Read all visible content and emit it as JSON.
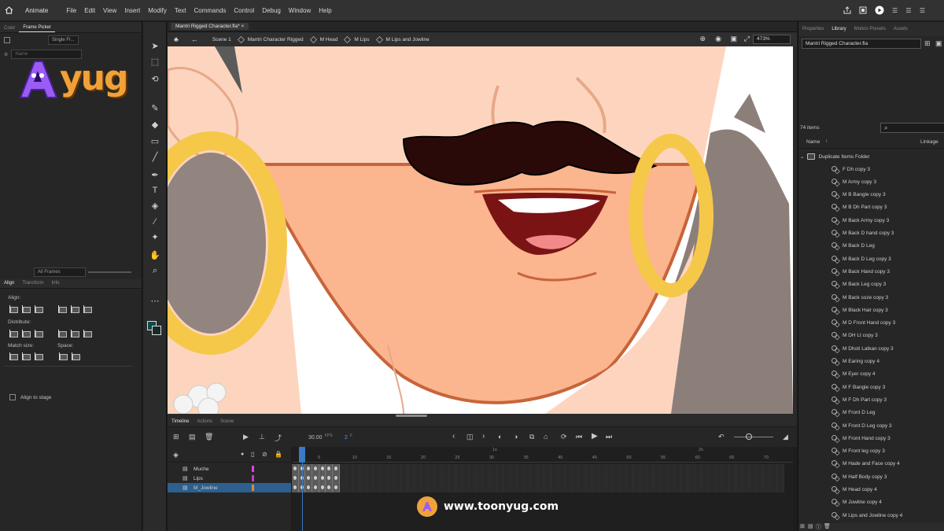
{
  "menubar": {
    "app_name": "Animate",
    "menus": [
      "File",
      "Edit",
      "View",
      "Insert",
      "Modify",
      "Text",
      "Commands",
      "Control",
      "Debug",
      "Window",
      "Help"
    ]
  },
  "left_panel": {
    "tabs": [
      "Color",
      "Frame Picker"
    ],
    "frame_picker_select": "Single Fr...",
    "frame_picker_name_placeholder": "Name",
    "logo_text": "yug",
    "all_frames": "All Frames",
    "align_tabs": [
      "Align",
      "Transform",
      "Info"
    ],
    "align_label": "Align:",
    "distribute_label": "Distribute:",
    "match_size_label": "Match size:",
    "space_label": "Space:",
    "align_to_stage": "Align to stage"
  },
  "document": {
    "tab_title": "Mantri Rigged Character.fla*",
    "breadcrumbs": [
      "Scene 1",
      "Mantri Character Rigged",
      "M Head",
      "M Lips",
      "M Lips and Jowline"
    ],
    "zoom": "473%"
  },
  "timeline": {
    "tabs": [
      "Timeline",
      "Actions",
      "Scene"
    ],
    "fps": "30.00",
    "fps_unit": "FPS",
    "frame": "2",
    "frame_unit": "F",
    "ruler_marks": [
      "5",
      "10",
      "15",
      "20",
      "25",
      "30",
      "35",
      "40",
      "45",
      "50",
      "55",
      "60",
      "65",
      "70"
    ],
    "ruler_seconds": [
      "1s",
      "2s"
    ],
    "layers": [
      {
        "name": "Muche",
        "color": "#e040e0",
        "selected": false
      },
      {
        "name": "Lips",
        "color": "#c040c0",
        "selected": false
      },
      {
        "name": "M_Jowline",
        "color": "#e08a3a",
        "selected": true
      }
    ],
    "keyframe_count": 7
  },
  "watermark_url": "www.toonyug.com",
  "library": {
    "tabs": [
      "Properties",
      "Library",
      "Motion Presets",
      "Assets"
    ],
    "active_tab": "Library",
    "file_select": "Mantri Rigged Character.fla",
    "item_count": "74 items",
    "col_name": "Name",
    "col_linkage": "Linkage",
    "folder": "Duplicate Items Folder",
    "items": [
      "F Dh copy 3",
      "M Army copy 3",
      "M B Bangle copy 3",
      "M B Dh Part copy 3",
      "M Back Army copy 3",
      "M Back D hand copy 3",
      "M Back D Leg",
      "M Back D Leg copy 3",
      "M Back Hand copy 3",
      "M Back Leg copy 3",
      "M Back soze copy 3",
      "M Black Hair copy 3",
      "M D Front Hand copy 3",
      "M DH Lt copy 3",
      "M Dhoti Latkan copy 3",
      "M Earing copy 4",
      "M Eyer copy 4",
      "M F Bangle copy 3",
      "M F Dh Part copy 3",
      "M Front D Leg",
      "M Front D Leg copy 3",
      "M Front Hand copy 3",
      "M Front leg copy 3",
      "M Hade and Face copy 4",
      "M Half Body copy 3",
      "M Head copy 4",
      "M Jowline copy 4",
      "M Lips and Jowline copy 4"
    ]
  },
  "colors": {
    "skin_light": "#fdd5bf",
    "skin_dark": "#fbb58f",
    "outline": "#c8643a",
    "mustache": "#2a0a08",
    "earring": "#f5c84a",
    "hair": "#8c7f7a",
    "accent_blue": "#3a78c8"
  }
}
